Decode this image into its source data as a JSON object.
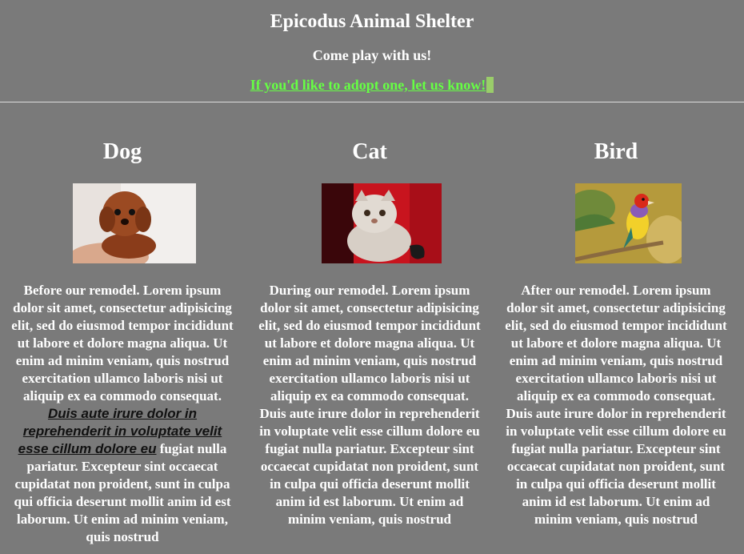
{
  "header": {
    "title": "Epicodus Animal Shelter",
    "tagline": "Come play with us!",
    "adopt_link": "If you'd like to adopt one, let us know!"
  },
  "animals": [
    {
      "name": "Dog",
      "photo_icon": "dog-photo",
      "text_before": "Before our remodel. Lorem ipsum dolor sit amet, consectetur adipisicing elit, sed do eiusmod tempor incididunt ut labore et dolore magna aliqua. Ut enim ad minim veniam, quis nostrud exercitation ullamco laboris nisi ut aliquip ex ea commodo consequat.",
      "text_link": "Duis aute irure dolor in reprehenderit in voluptate velit esse cillum dolore eu",
      "text_after": "fugiat nulla pariatur. Excepteur sint occaecat cupidatat non proident, sunt in culpa qui officia deserunt mollit anim id est laborum. Ut enim ad minim veniam, quis nostrud"
    },
    {
      "name": "Cat",
      "photo_icon": "cat-photo",
      "text": "During our remodel. Lorem ipsum dolor sit amet, consectetur adipisicing elit, sed do eiusmod tempor incididunt ut labore et dolore magna aliqua. Ut enim ad minim veniam, quis nostrud exercitation ullamco laboris nisi ut aliquip ex ea commodo consequat. Duis aute irure dolor in reprehenderit in voluptate velit esse cillum dolore eu fugiat nulla pariatur. Excepteur sint occaecat cupidatat non proident, sunt in culpa qui officia deserunt mollit anim id est laborum. Ut enim ad minim veniam, quis nostrud"
    },
    {
      "name": "Bird",
      "photo_icon": "bird-photo",
      "text": "After our remodel. Lorem ipsum dolor sit amet, consectetur adipisicing elit, sed do eiusmod tempor incididunt ut labore et dolore magna aliqua. Ut enim ad minim veniam, quis nostrud exercitation ullamco laboris nisi ut aliquip ex ea commodo consequat. Duis aute irure dolor in reprehenderit in voluptate velit esse cillum dolore eu fugiat nulla pariatur. Excepteur sint occaecat cupidatat non proident, sunt in culpa qui officia deserunt mollit anim id est laborum. Ut enim ad minim veniam, quis nostrud"
    }
  ],
  "colors": {
    "background": "#7a7a7a",
    "text": "#ffffff",
    "link": "#66ff44"
  }
}
